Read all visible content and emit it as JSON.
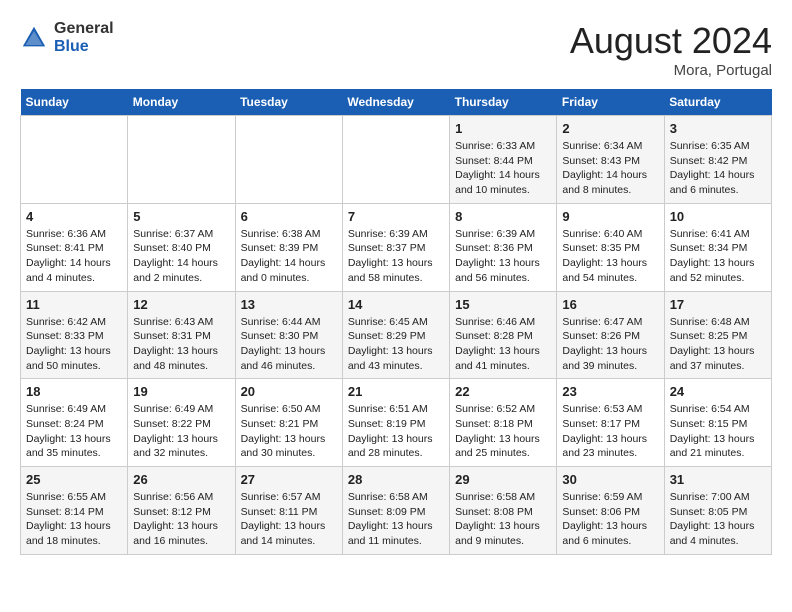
{
  "header": {
    "logo_general": "General",
    "logo_blue": "Blue",
    "month_year": "August 2024",
    "location": "Mora, Portugal"
  },
  "days_of_week": [
    "Sunday",
    "Monday",
    "Tuesday",
    "Wednesday",
    "Thursday",
    "Friday",
    "Saturday"
  ],
  "weeks": [
    [
      {
        "day": "",
        "info": ""
      },
      {
        "day": "",
        "info": ""
      },
      {
        "day": "",
        "info": ""
      },
      {
        "day": "",
        "info": ""
      },
      {
        "day": "1",
        "info": "Sunrise: 6:33 AM\nSunset: 8:44 PM\nDaylight: 14 hours and 10 minutes."
      },
      {
        "day": "2",
        "info": "Sunrise: 6:34 AM\nSunset: 8:43 PM\nDaylight: 14 hours and 8 minutes."
      },
      {
        "day": "3",
        "info": "Sunrise: 6:35 AM\nSunset: 8:42 PM\nDaylight: 14 hours and 6 minutes."
      }
    ],
    [
      {
        "day": "4",
        "info": "Sunrise: 6:36 AM\nSunset: 8:41 PM\nDaylight: 14 hours and 4 minutes."
      },
      {
        "day": "5",
        "info": "Sunrise: 6:37 AM\nSunset: 8:40 PM\nDaylight: 14 hours and 2 minutes."
      },
      {
        "day": "6",
        "info": "Sunrise: 6:38 AM\nSunset: 8:39 PM\nDaylight: 14 hours and 0 minutes."
      },
      {
        "day": "7",
        "info": "Sunrise: 6:39 AM\nSunset: 8:37 PM\nDaylight: 13 hours and 58 minutes."
      },
      {
        "day": "8",
        "info": "Sunrise: 6:39 AM\nSunset: 8:36 PM\nDaylight: 13 hours and 56 minutes."
      },
      {
        "day": "9",
        "info": "Sunrise: 6:40 AM\nSunset: 8:35 PM\nDaylight: 13 hours and 54 minutes."
      },
      {
        "day": "10",
        "info": "Sunrise: 6:41 AM\nSunset: 8:34 PM\nDaylight: 13 hours and 52 minutes."
      }
    ],
    [
      {
        "day": "11",
        "info": "Sunrise: 6:42 AM\nSunset: 8:33 PM\nDaylight: 13 hours and 50 minutes."
      },
      {
        "day": "12",
        "info": "Sunrise: 6:43 AM\nSunset: 8:31 PM\nDaylight: 13 hours and 48 minutes."
      },
      {
        "day": "13",
        "info": "Sunrise: 6:44 AM\nSunset: 8:30 PM\nDaylight: 13 hours and 46 minutes."
      },
      {
        "day": "14",
        "info": "Sunrise: 6:45 AM\nSunset: 8:29 PM\nDaylight: 13 hours and 43 minutes."
      },
      {
        "day": "15",
        "info": "Sunrise: 6:46 AM\nSunset: 8:28 PM\nDaylight: 13 hours and 41 minutes."
      },
      {
        "day": "16",
        "info": "Sunrise: 6:47 AM\nSunset: 8:26 PM\nDaylight: 13 hours and 39 minutes."
      },
      {
        "day": "17",
        "info": "Sunrise: 6:48 AM\nSunset: 8:25 PM\nDaylight: 13 hours and 37 minutes."
      }
    ],
    [
      {
        "day": "18",
        "info": "Sunrise: 6:49 AM\nSunset: 8:24 PM\nDaylight: 13 hours and 35 minutes."
      },
      {
        "day": "19",
        "info": "Sunrise: 6:49 AM\nSunset: 8:22 PM\nDaylight: 13 hours and 32 minutes."
      },
      {
        "day": "20",
        "info": "Sunrise: 6:50 AM\nSunset: 8:21 PM\nDaylight: 13 hours and 30 minutes."
      },
      {
        "day": "21",
        "info": "Sunrise: 6:51 AM\nSunset: 8:19 PM\nDaylight: 13 hours and 28 minutes."
      },
      {
        "day": "22",
        "info": "Sunrise: 6:52 AM\nSunset: 8:18 PM\nDaylight: 13 hours and 25 minutes."
      },
      {
        "day": "23",
        "info": "Sunrise: 6:53 AM\nSunset: 8:17 PM\nDaylight: 13 hours and 23 minutes."
      },
      {
        "day": "24",
        "info": "Sunrise: 6:54 AM\nSunset: 8:15 PM\nDaylight: 13 hours and 21 minutes."
      }
    ],
    [
      {
        "day": "25",
        "info": "Sunrise: 6:55 AM\nSunset: 8:14 PM\nDaylight: 13 hours and 18 minutes."
      },
      {
        "day": "26",
        "info": "Sunrise: 6:56 AM\nSunset: 8:12 PM\nDaylight: 13 hours and 16 minutes."
      },
      {
        "day": "27",
        "info": "Sunrise: 6:57 AM\nSunset: 8:11 PM\nDaylight: 13 hours and 14 minutes."
      },
      {
        "day": "28",
        "info": "Sunrise: 6:58 AM\nSunset: 8:09 PM\nDaylight: 13 hours and 11 minutes."
      },
      {
        "day": "29",
        "info": "Sunrise: 6:58 AM\nSunset: 8:08 PM\nDaylight: 13 hours and 9 minutes."
      },
      {
        "day": "30",
        "info": "Sunrise: 6:59 AM\nSunset: 8:06 PM\nDaylight: 13 hours and 6 minutes."
      },
      {
        "day": "31",
        "info": "Sunrise: 7:00 AM\nSunset: 8:05 PM\nDaylight: 13 hours and 4 minutes."
      }
    ]
  ]
}
